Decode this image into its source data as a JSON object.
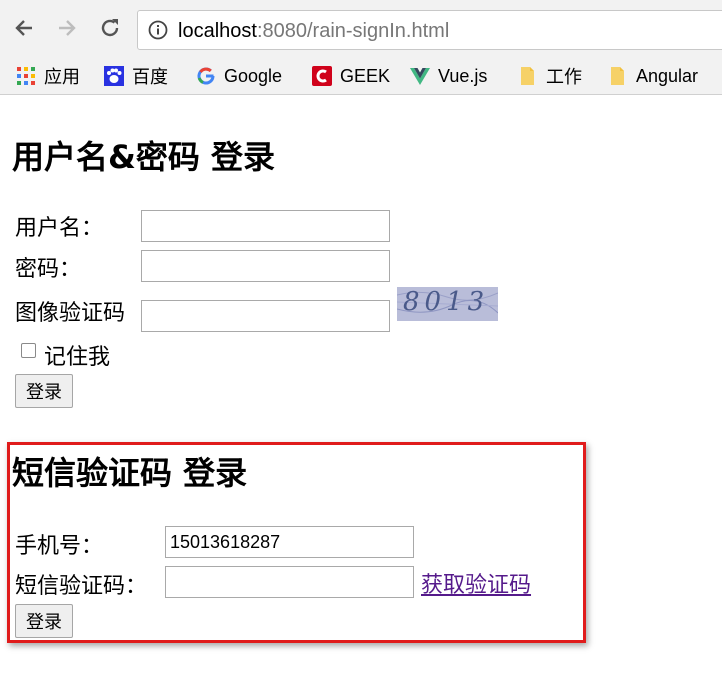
{
  "browser": {
    "url_host": "localhost",
    "url_rest": ":8080/rain-signIn.html",
    "bookmarks": [
      {
        "label": "应用",
        "icon": "apps-grid-icon"
      },
      {
        "label": "百度",
        "icon": "baidu-paw-icon"
      },
      {
        "label": "Google",
        "icon": "google-g-icon"
      },
      {
        "label": "GEEK",
        "icon": "geek-icon"
      },
      {
        "label": "Vue.js",
        "icon": "vue-icon"
      },
      {
        "label": "工作",
        "icon": "folder-icon"
      },
      {
        "label": "Angular",
        "icon": "folder-icon"
      }
    ]
  },
  "password_login": {
    "heading": "用户名&密码 登录",
    "username_label": "用户名：",
    "username_value": "",
    "password_label": "密码：",
    "password_value": "",
    "captcha_label": "图像验证码",
    "captcha_value": "",
    "captcha_image_text": "8013",
    "remember_label": "记住我",
    "remember_checked": false,
    "submit_label": "登录"
  },
  "sms_login": {
    "heading": "短信验证码 登录",
    "phone_label": "手机号：",
    "phone_value": "15013618287",
    "sms_code_label": "短信验证码：",
    "sms_code_value": "",
    "get_code_link": "获取验证码",
    "submit_label": "登录"
  },
  "colors": {
    "highlight_border": "#e01b1b",
    "visited_link": "#551a8b"
  }
}
